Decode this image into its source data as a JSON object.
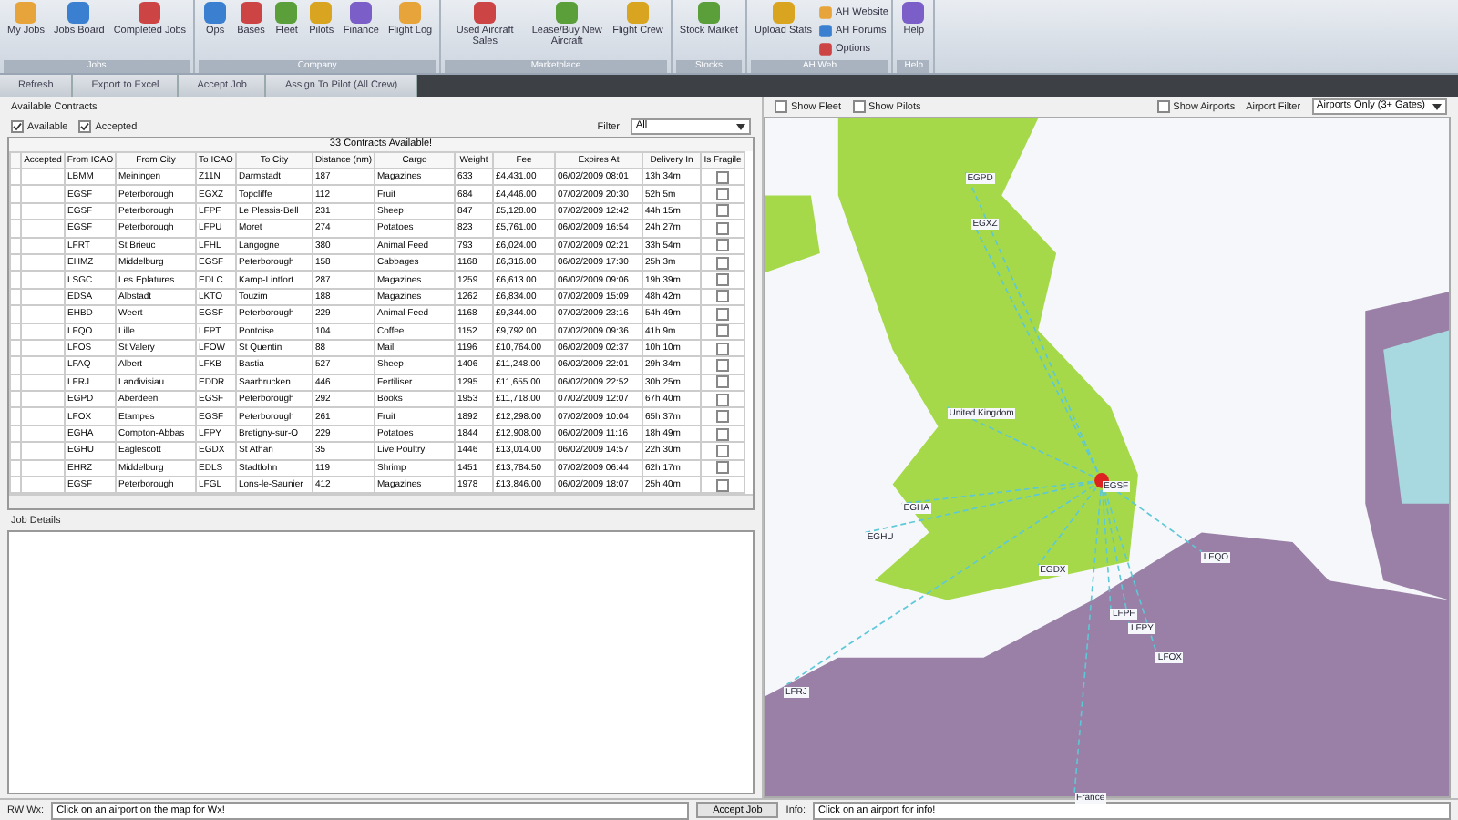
{
  "ribbon": {
    "groups": [
      {
        "title": "Jobs",
        "buttons": [
          "My Jobs",
          "Jobs Board",
          "Completed Jobs"
        ]
      },
      {
        "title": "Company",
        "buttons": [
          "Ops",
          "Bases",
          "Fleet",
          "Pilots",
          "Finance",
          "Flight Log"
        ]
      },
      {
        "title": "Marketplace",
        "buttons": [
          "Used Aircraft Sales",
          "Lease/Buy New Aircraft",
          "Flight Crew"
        ]
      },
      {
        "title": "Stocks",
        "buttons": [
          "Stock Market"
        ]
      },
      {
        "title": "AH Web",
        "buttons": [
          "Upload Stats"
        ],
        "links": [
          "AH Website",
          "AH Forums",
          "Options"
        ]
      },
      {
        "title": "Help",
        "buttons": [
          "Help"
        ]
      }
    ]
  },
  "toolbar": [
    "Refresh",
    "Export to Excel",
    "Accept Job",
    "Assign To Pilot (All Crew)"
  ],
  "contracts": {
    "title": "Available Contracts",
    "toggles": [
      {
        "label": "Available",
        "checked": true
      },
      {
        "label": "Accepted",
        "checked": true
      }
    ],
    "filter": {
      "label": "Filter",
      "value": "All"
    },
    "count": "33 Contracts Available!",
    "columns": [
      "Accepted",
      "From ICAO",
      "From City",
      "To ICAO",
      "To City",
      "Distance (nm)",
      "Cargo",
      "Weight",
      "Fee",
      "Expires At",
      "Delivery In",
      "Is Fragile"
    ],
    "rows": [
      {
        "cells": [
          "",
          "LBMM",
          "Meiningen",
          "Z11N",
          "Darmstadt",
          "187",
          "Magazines",
          "633",
          "£4,431.00",
          "06/02/2009 08:01",
          "13h 34m"
        ],
        "fragile": false
      },
      {
        "cells": [
          "",
          "EGSF",
          "Peterborough",
          "EGXZ",
          "Topcliffe",
          "112",
          "Fruit",
          "684",
          "£4,446.00",
          "07/02/2009 20:30",
          "52h 5m"
        ],
        "fragile": false
      },
      {
        "cells": [
          "",
          "EGSF",
          "Peterborough",
          "LFPF",
          "Le Plessis-Bell",
          "231",
          "Sheep",
          "847",
          "£5,128.00",
          "07/02/2009 12:42",
          "44h 15m"
        ],
        "fragile": false
      },
      {
        "cells": [
          "",
          "EGSF",
          "Peterborough",
          "LFPU",
          "Moret",
          "274",
          "Potatoes",
          "823",
          "£5,761.00",
          "06/02/2009 16:54",
          "24h 27m"
        ],
        "fragile": false
      },
      {
        "cells": [
          "",
          "LFRT",
          "St Brieuc",
          "LFHL",
          "Langogne",
          "380",
          "Animal Feed",
          "793",
          "£6,024.00",
          "07/02/2009 02:21",
          "33h 54m"
        ],
        "fragile": false
      },
      {
        "cells": [
          "",
          "EHMZ",
          "Middelburg",
          "EGSF",
          "Peterborough",
          "158",
          "Cabbages",
          "1168",
          "£6,316.00",
          "06/02/2009 17:30",
          "25h 3m"
        ],
        "fragile": false
      },
      {
        "cells": [
          "",
          "LSGC",
          "Les Eplatures",
          "EDLC",
          "Kamp-Lintfort",
          "287",
          "Magazines",
          "1259",
          "£6,613.00",
          "06/02/2009 09:06",
          "19h 39m"
        ],
        "fragile": false
      },
      {
        "cells": [
          "",
          "EDSA",
          "Albstadt",
          "LKTO",
          "Touzim",
          "188",
          "Magazines",
          "1262",
          "£6,834.00",
          "07/02/2009 15:09",
          "48h 42m"
        ],
        "fragile": false
      },
      {
        "cells": [
          "",
          "EHBD",
          "Weert",
          "EGSF",
          "Peterborough",
          "229",
          "Animal Feed",
          "1168",
          "£9,344.00",
          "07/02/2009 23:16",
          "54h 49m"
        ],
        "fragile": false
      },
      {
        "cells": [
          "",
          "LFQO",
          "Lille",
          "LFPT",
          "Pontoise",
          "104",
          "Coffee",
          "1152",
          "£9,792.00",
          "07/02/2009 09:36",
          "41h 9m"
        ],
        "fragile": false
      },
      {
        "cells": [
          "",
          "LFOS",
          "St Valery",
          "LFOW",
          "St Quentin",
          "88",
          "Mail",
          "1196",
          "£10,764.00",
          "06/02/2009 02:37",
          "10h 10m"
        ],
        "fragile": false
      },
      {
        "cells": [
          "",
          "LFAQ",
          "Albert",
          "LFKB",
          "Bastia",
          "527",
          "Sheep",
          "1406",
          "£11,248.00",
          "06/02/2009 22:01",
          "29h 34m"
        ],
        "fragile": false
      },
      {
        "cells": [
          "",
          "LFRJ",
          "Landivisiau",
          "EDDR",
          "Saarbrucken",
          "446",
          "Fertiliser",
          "1295",
          "£11,655.00",
          "06/02/2009 22:52",
          "30h 25m"
        ],
        "fragile": false
      },
      {
        "cells": [
          "",
          "EGPD",
          "Aberdeen",
          "EGSF",
          "Peterborough",
          "292",
          "Books",
          "1953",
          "£11,718.00",
          "07/02/2009 12:07",
          "67h 40m"
        ],
        "fragile": false
      },
      {
        "cells": [
          "",
          "LFOX",
          "Etampes",
          "EGSF",
          "Peterborough",
          "261",
          "Fruit",
          "1892",
          "£12,298.00",
          "07/02/2009 10:04",
          "65h 37m"
        ],
        "fragile": false
      },
      {
        "cells": [
          "",
          "EGHA",
          "Compton-Abbas",
          "LFPY",
          "Bretigny-sur-O",
          "229",
          "Potatoes",
          "1844",
          "£12,908.00",
          "06/02/2009 11:16",
          "18h 49m"
        ],
        "fragile": false
      },
      {
        "cells": [
          "",
          "EGHU",
          "Eaglescott",
          "EGDX",
          "St Athan",
          "35",
          "Live Poultry",
          "1446",
          "£13,014.00",
          "06/02/2009 14:57",
          "22h 30m"
        ],
        "fragile": false
      },
      {
        "cells": [
          "",
          "EHRZ",
          "Middelburg",
          "EDLS",
          "Stadtlohn",
          "119",
          "Shrimp",
          "1451",
          "£13,784.50",
          "07/02/2009 06:44",
          "62h 17m"
        ],
        "fragile": false
      },
      {
        "cells": [
          "",
          "EGSF",
          "Peterborough",
          "LFGL",
          "Lons-le-Saunier",
          "412",
          "Magazines",
          "1978",
          "£13,846.00",
          "06/02/2009 18:07",
          "25h 40m"
        ],
        "fragile": false
      }
    ]
  },
  "job_details": {
    "title": "Job Details"
  },
  "map_options": {
    "toggles": [
      {
        "label": "Show Fleet",
        "checked": false
      },
      {
        "label": "Show Pilots",
        "checked": false
      }
    ],
    "airports": {
      "label": "Show Airports",
      "checked": false
    },
    "airport_filter": {
      "label": "Airport Filter",
      "value": "Airports Only (3+ Gates)"
    }
  },
  "map_labels": [
    "United Kingdom",
    "France",
    "EGSF",
    "EGXZ",
    "EGPD",
    "EGHU",
    "EGHA",
    "EGDX",
    "LFQO",
    "LFRJ",
    "LFOX",
    "LFPY",
    "LFPF"
  ],
  "footer": {
    "wx_label": "RW Wx:",
    "wx_value": "Click on an airport on the map for Wx!",
    "button": "Accept Job",
    "info_label": "Info:",
    "info_value": "Click on an airport for info!"
  }
}
